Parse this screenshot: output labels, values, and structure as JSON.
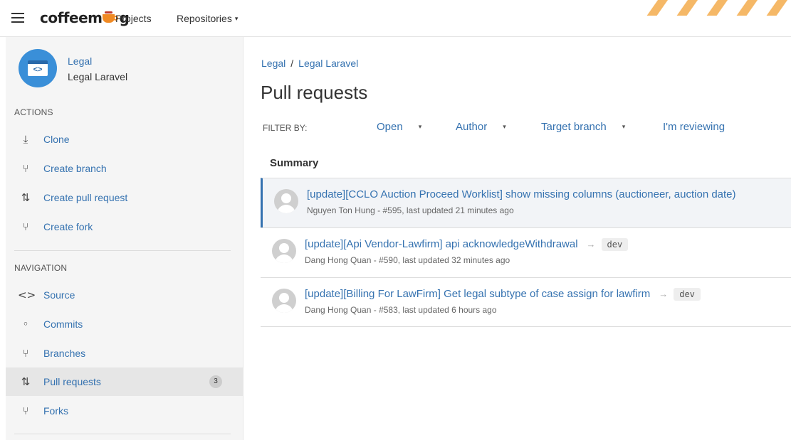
{
  "header": {
    "logo_left": "coffeem",
    "logo_right": "g",
    "nav": [
      {
        "label": "Projects"
      },
      {
        "label": "Repositories"
      }
    ],
    "repos_caret": "▾"
  },
  "sidebar": {
    "repo": {
      "project": "Legal",
      "name": "Legal Laravel",
      "icon_glyph": "<>"
    },
    "actions_title": "ACTIONS",
    "actions": [
      {
        "label": "Clone",
        "icon": "clone-icon",
        "glyph": "⤓"
      },
      {
        "label": "Create branch",
        "icon": "branch-icon",
        "glyph": "⑂"
      },
      {
        "label": "Create pull request",
        "icon": "pull-request-icon",
        "glyph": "⇅"
      },
      {
        "label": "Create fork",
        "icon": "fork-icon",
        "glyph": "⑂"
      }
    ],
    "navigation_title": "NAVIGATION",
    "navigation": [
      {
        "label": "Source",
        "icon": "source-icon",
        "glyph": "<>"
      },
      {
        "label": "Commits",
        "icon": "commit-icon",
        "glyph": "◦"
      },
      {
        "label": "Branches",
        "icon": "branches-icon",
        "glyph": "⑂"
      },
      {
        "label": "Pull requests",
        "icon": "pull-requests-icon",
        "glyph": "⇅",
        "badge": "3",
        "active": true
      },
      {
        "label": "Forks",
        "icon": "forks-icon",
        "glyph": "⑂"
      }
    ]
  },
  "main": {
    "breadcrumb": {
      "project": "Legal",
      "separator": "/",
      "repo": "Legal Laravel"
    },
    "title": "Pull requests",
    "filter_label": "FILTER BY:",
    "filters": [
      {
        "label": "Open",
        "has_caret": true
      },
      {
        "label": "Author",
        "has_caret": true
      },
      {
        "label": "Target branch",
        "has_caret": true
      },
      {
        "label": "I'm reviewing",
        "has_caret": false
      }
    ],
    "filter_caret": "▾",
    "summary_header": "Summary",
    "pull_requests": [
      {
        "title": "[update][CCLO Auction Proceed Worklist] show missing columns (auctioneer, auction date)",
        "target": "",
        "meta": "Nguyen Ton Hung - #595, last updated 21 minutes ago",
        "selected": true
      },
      {
        "title": "[update][Api Vendor-Lawfirm] api acknowledgeWithdrawal",
        "target": "dev",
        "meta": "Dang Hong Quan - #590, last updated 32 minutes ago",
        "selected": false
      },
      {
        "title": "[update][Billing For LawFirm] Get legal subtype of case assign for lawfirm",
        "target": "dev",
        "meta": "Dang Hong Quan - #583, last updated 6 hours ago",
        "selected": false
      }
    ],
    "arrow_glyph": "→"
  },
  "colors": {
    "link": "#3572b0",
    "brand_orange": "#f08a24",
    "sidebar_bg": "#f5f5f5",
    "active_item_bg": "#e6e6e6"
  }
}
